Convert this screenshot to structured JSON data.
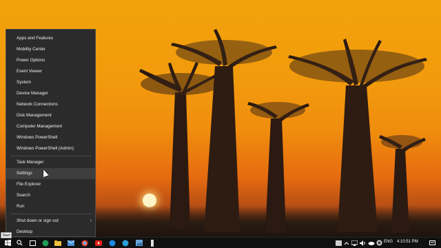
{
  "start_menu": {
    "items": [
      {
        "label": "Apps and Features"
      },
      {
        "label": "Mobility Center"
      },
      {
        "label": "Power Options"
      },
      {
        "label": "Event Viewer"
      },
      {
        "label": "System"
      },
      {
        "label": "Device Manager"
      },
      {
        "label": "Network Connections"
      },
      {
        "label": "Disk Management"
      },
      {
        "label": "Computer Management"
      },
      {
        "label": "Windows PowerShell"
      },
      {
        "label": "Windows PowerShell (Admin)"
      },
      {
        "label": "Task Manager"
      },
      {
        "label": "Settings"
      },
      {
        "label": "File Explorer"
      },
      {
        "label": "Search"
      },
      {
        "label": "Run"
      },
      {
        "label": "Shut down or sign out"
      },
      {
        "label": "Desktop"
      }
    ],
    "hovered_item": "Settings"
  },
  "taskbar": {
    "start_tooltip": "Start",
    "language": "ENG",
    "time": "4:10:51 PM",
    "accent_color": "#0078d7"
  },
  "icons": {
    "shutdown_chevron": "chevron-right-icon",
    "search": "search-icon",
    "windows": "windows-logo-icon"
  }
}
